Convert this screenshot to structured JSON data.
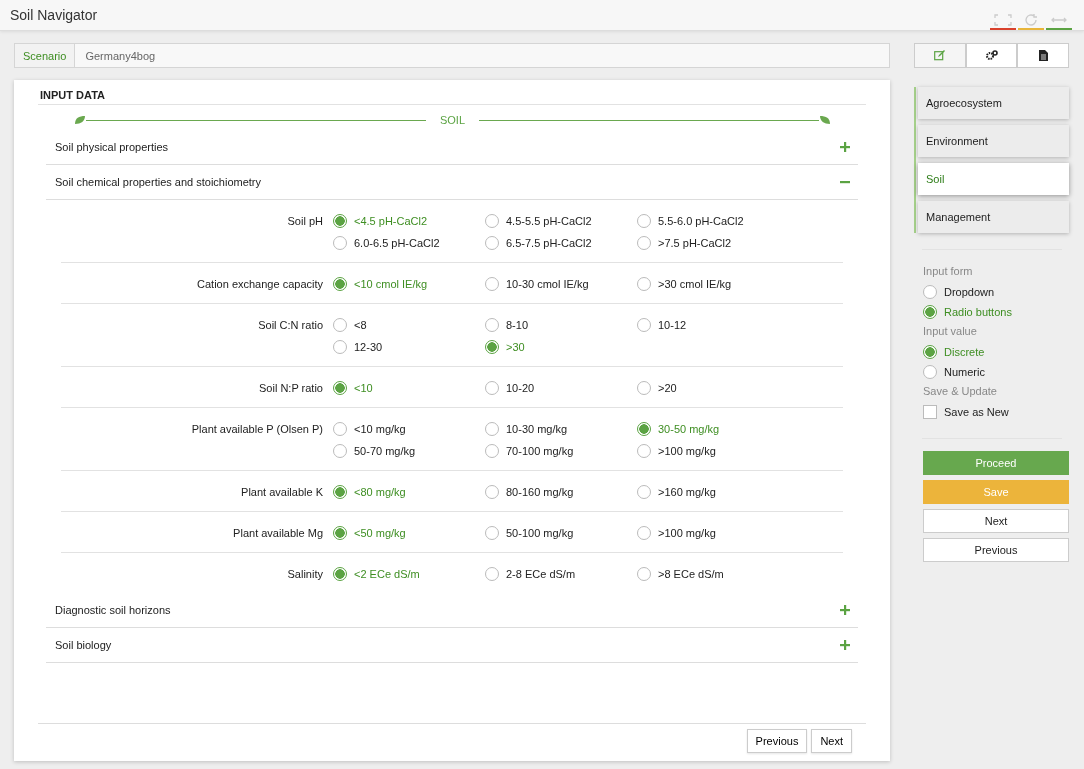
{
  "app": {
    "title": "Soil Navigator"
  },
  "scenario": {
    "label": "Scenario",
    "value": "Germany4bog"
  },
  "card": {
    "title": "INPUT DATA",
    "divider_label": "SOIL",
    "sections": [
      {
        "title": "Soil physical properties",
        "expanded": false
      },
      {
        "title": "Soil chemical properties and stoichiometry",
        "expanded": true,
        "properties": [
          {
            "label": "Soil pH",
            "options": [
              {
                "label": "<4.5 pH-CaCl2",
                "selected": true
              },
              {
                "label": "4.5-5.5 pH-CaCl2",
                "selected": false
              },
              {
                "label": "5.5-6.0 pH-CaCl2",
                "selected": false
              },
              {
                "label": "6.0-6.5 pH-CaCl2",
                "selected": false
              },
              {
                "label": "6.5-7.5 pH-CaCl2",
                "selected": false
              },
              {
                "label": ">7.5 pH-CaCl2",
                "selected": false
              }
            ]
          },
          {
            "label": "Cation exchange capacity",
            "options": [
              {
                "label": "<10 cmol IE/kg",
                "selected": true
              },
              {
                "label": "10-30 cmol IE/kg",
                "selected": false
              },
              {
                "label": ">30 cmol IE/kg",
                "selected": false
              }
            ]
          },
          {
            "label": "Soil C:N ratio",
            "options": [
              {
                "label": "<8",
                "selected": false
              },
              {
                "label": "8-10",
                "selected": false
              },
              {
                "label": "10-12",
                "selected": false
              },
              {
                "label": "12-30",
                "selected": false
              },
              {
                "label": ">30",
                "selected": true
              }
            ]
          },
          {
            "label": "Soil N:P ratio",
            "options": [
              {
                "label": "<10",
                "selected": true
              },
              {
                "label": "10-20",
                "selected": false
              },
              {
                "label": ">20",
                "selected": false
              }
            ]
          },
          {
            "label": "Plant available P (Olsen P)",
            "options": [
              {
                "label": "<10 mg/kg",
                "selected": false
              },
              {
                "label": "10-30 mg/kg",
                "selected": false
              },
              {
                "label": "30-50 mg/kg",
                "selected": true
              },
              {
                "label": "50-70 mg/kg",
                "selected": false
              },
              {
                "label": "70-100 mg/kg",
                "selected": false
              },
              {
                "label": ">100 mg/kg",
                "selected": false
              }
            ]
          },
          {
            "label": "Plant available K",
            "options": [
              {
                "label": "<80 mg/kg",
                "selected": true
              },
              {
                "label": "80-160 mg/kg",
                "selected": false
              },
              {
                "label": ">160 mg/kg",
                "selected": false
              }
            ]
          },
          {
            "label": "Plant available Mg",
            "options": [
              {
                "label": "<50 mg/kg",
                "selected": true
              },
              {
                "label": "50-100 mg/kg",
                "selected": false
              },
              {
                "label": ">100 mg/kg",
                "selected": false
              }
            ]
          },
          {
            "label": "Salinity",
            "options": [
              {
                "label": "<2 ECe dS/m",
                "selected": true
              },
              {
                "label": "2-8 ECe dS/m",
                "selected": false
              },
              {
                "label": ">8 ECe dS/m",
                "selected": false
              }
            ]
          }
        ]
      },
      {
        "title": "Diagnostic soil horizons",
        "expanded": false
      },
      {
        "title": "Soil biology",
        "expanded": false
      }
    ],
    "footer_buttons": [
      "Previous",
      "Next"
    ]
  },
  "nav": [
    {
      "label": "Agroecosystem",
      "selected": false
    },
    {
      "label": "Environment",
      "selected": false
    },
    {
      "label": "Soil",
      "selected": true
    },
    {
      "label": "Management",
      "selected": false
    }
  ],
  "settings": [
    {
      "heading": "Input form",
      "kind": "radio",
      "options": [
        {
          "label": "Dropdown",
          "selected": false
        },
        {
          "label": "Radio buttons",
          "selected": true
        }
      ]
    },
    {
      "heading": "Input value",
      "kind": "radio",
      "options": [
        {
          "label": "Discrete",
          "selected": true
        },
        {
          "label": "Numeric",
          "selected": false
        }
      ]
    },
    {
      "heading": "Save & Update",
      "kind": "checkbox",
      "options": [
        {
          "label": "Save as New",
          "checked": false
        }
      ]
    }
  ],
  "actions": [
    {
      "label": "Proceed",
      "kind": "primary"
    },
    {
      "label": "Save",
      "kind": "warning"
    },
    {
      "label": "Next",
      "kind": "default"
    },
    {
      "label": "Previous",
      "kind": "default"
    }
  ]
}
